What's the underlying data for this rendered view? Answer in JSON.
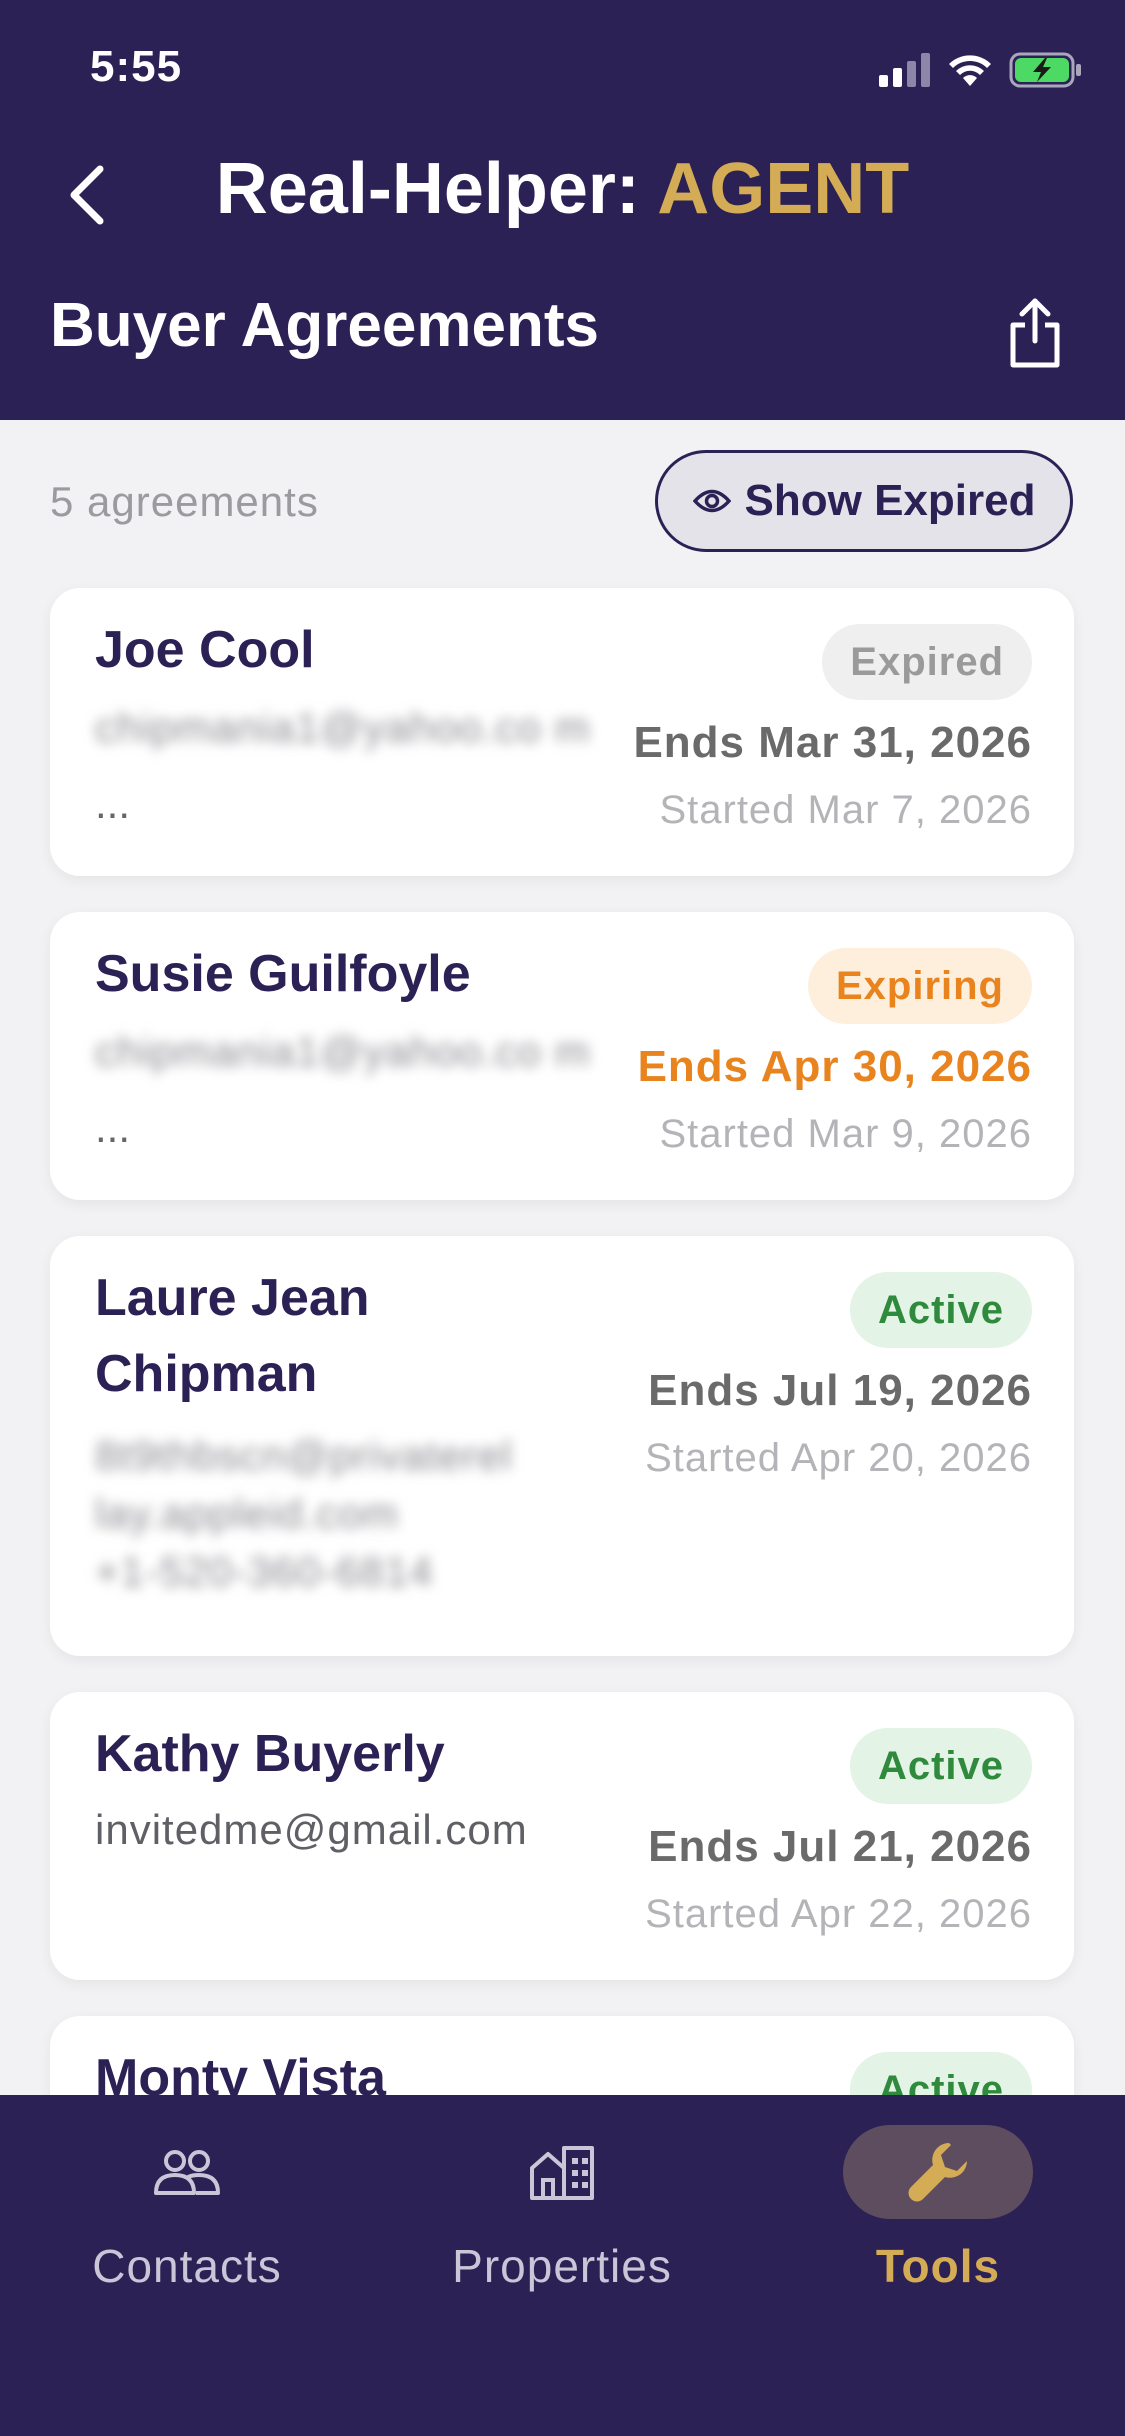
{
  "status_bar": {
    "time": "5:55"
  },
  "header": {
    "back_icon": "chevron-left-icon",
    "app_title_prefix": "Real-Helper: ",
    "app_title_accent": "AGENT",
    "page_title": "Buyer Agreements",
    "share_icon": "share-icon"
  },
  "toolbar": {
    "count_label": "5 agreements",
    "show_expired_label": "Show Expired",
    "show_expired_icon": "eye-icon"
  },
  "agreements": [
    {
      "name": "Joe Cool",
      "email": "chipmania1@yahoo.co m",
      "email_blurred": true,
      "ellipsis": "...",
      "status": "Expired",
      "ends": "Ends Mar 31, 2026",
      "started": "Started Mar 7, 2026"
    },
    {
      "name": "Susie Guilfoyle",
      "email": "chipmania1@yahoo.co m",
      "email_blurred": true,
      "ellipsis": "...",
      "status": "Expiring",
      "ends": "Ends Apr 30, 2026",
      "started": "Started Mar 9, 2026"
    },
    {
      "name_line1": "Laure Jean",
      "name_line2": "Chipman",
      "email_line1": "8t9thbscn@privaterel",
      "email_line2": "lay.appleid.com",
      "email_line3": "+1-520-360-6814",
      "email_blurred": true,
      "status": "Active",
      "ends": "Ends Jul 19, 2026",
      "started": "Started Apr 20, 2026"
    },
    {
      "name": "Kathy Buyerly",
      "email": "invitedme@gmail.com",
      "email_blurred": false,
      "status": "Active",
      "ends": "Ends Jul 21, 2026",
      "started": "Started Apr 22, 2026"
    },
    {
      "name": "Monty Vista",
      "status": "Active"
    }
  ],
  "bottom_nav": {
    "items": [
      {
        "label": "Contacts",
        "icon": "people-icon",
        "active": false
      },
      {
        "label": "Properties",
        "icon": "buildings-icon",
        "active": false
      },
      {
        "label": "Tools",
        "icon": "wrench-icon",
        "active": true
      }
    ]
  },
  "colors": {
    "brand_dark": "#2c2155",
    "accent_gold": "#d4ac55",
    "expiring_orange": "#e8831e",
    "active_green": "#2f8a3e",
    "background": "#f2f2f4"
  }
}
